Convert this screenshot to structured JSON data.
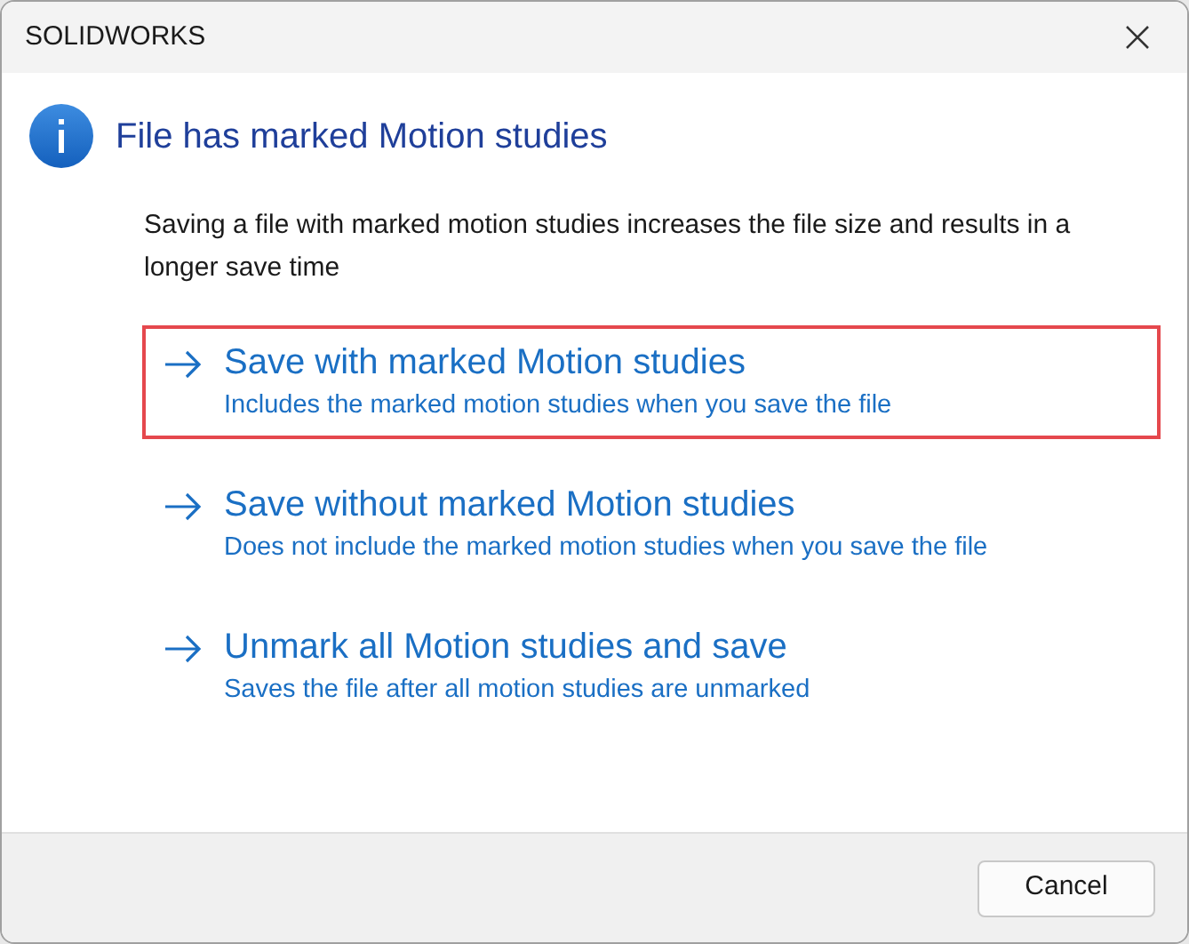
{
  "window": {
    "title": "SOLIDWORKS"
  },
  "heading": "File has marked Motion studies",
  "description": "Saving a file with marked motion studies increases the file size and results in a longer save time",
  "options": [
    {
      "title": "Save with marked Motion studies",
      "description": "Includes the marked motion studies when you save the file",
      "selected": true
    },
    {
      "title": "Save without marked Motion studies",
      "description": "Does not include the marked motion studies when you save the file",
      "selected": false
    },
    {
      "title": "Unmark all Motion studies and save",
      "description": "Saves the file after all motion studies are unmarked",
      "selected": false
    }
  ],
  "buttons": [
    "Cancel"
  ]
}
